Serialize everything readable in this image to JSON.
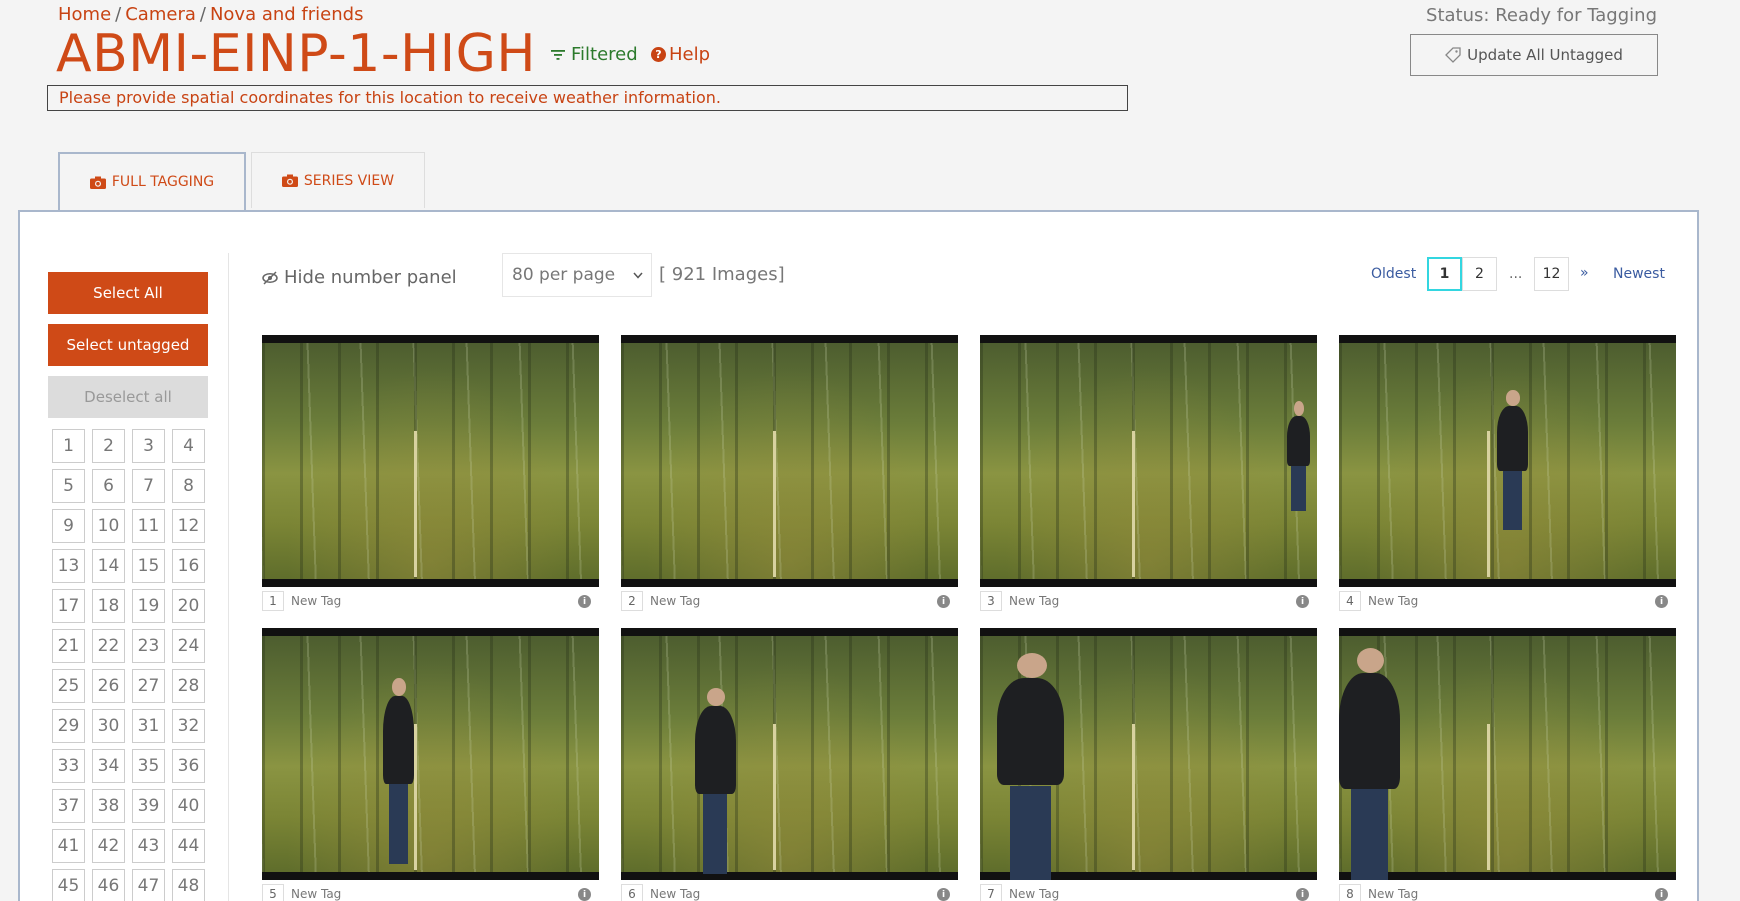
{
  "breadcrumb": {
    "home": "Home",
    "camera": "Camera",
    "project": "Nova and friends",
    "sep": "/"
  },
  "title": "ABMI-EINP-1-HIGH",
  "filter_label": "Filtered",
  "help_label": "Help",
  "status": "Status: Ready for Tagging",
  "update_button": "Update All Untagged",
  "weather_alert": "Please provide spatial coordinates for this location to receive weather information.",
  "tabs": [
    {
      "label": "FULL TAGGING"
    },
    {
      "label": "SERIES VIEW"
    }
  ],
  "sidebar": {
    "select_all": "Select All",
    "select_untagged": "Select untagged",
    "deselect_all": "Deselect all",
    "numbers": [
      "1",
      "2",
      "3",
      "4",
      "5",
      "6",
      "7",
      "8",
      "9",
      "10",
      "11",
      "12",
      "13",
      "14",
      "15",
      "16",
      "17",
      "18",
      "19",
      "20",
      "21",
      "22",
      "23",
      "24",
      "25",
      "26",
      "27",
      "28",
      "29",
      "30",
      "31",
      "32",
      "33",
      "34",
      "35",
      "36",
      "37",
      "38",
      "39",
      "40",
      "41",
      "42",
      "43",
      "44",
      "45",
      "46",
      "47",
      "48"
    ]
  },
  "toolbar": {
    "hide_panel": "Hide number panel",
    "per_page": "80 per page",
    "image_count": "[ 921 Images]"
  },
  "pagination": {
    "oldest": "Oldest",
    "pages": [
      "1",
      "2"
    ],
    "ellipsis": "...",
    "last": "12",
    "next": "»",
    "newest": "Newest",
    "current": "1"
  },
  "images": [
    {
      "num": "1",
      "tag": "New Tag"
    },
    {
      "num": "2",
      "tag": "New Tag"
    },
    {
      "num": "3",
      "tag": "New Tag"
    },
    {
      "num": "4",
      "tag": "New Tag"
    },
    {
      "num": "5",
      "tag": "New Tag"
    },
    {
      "num": "6",
      "tag": "New Tag"
    },
    {
      "num": "7",
      "tag": "New Tag"
    },
    {
      "num": "8",
      "tag": "New Tag"
    }
  ]
}
